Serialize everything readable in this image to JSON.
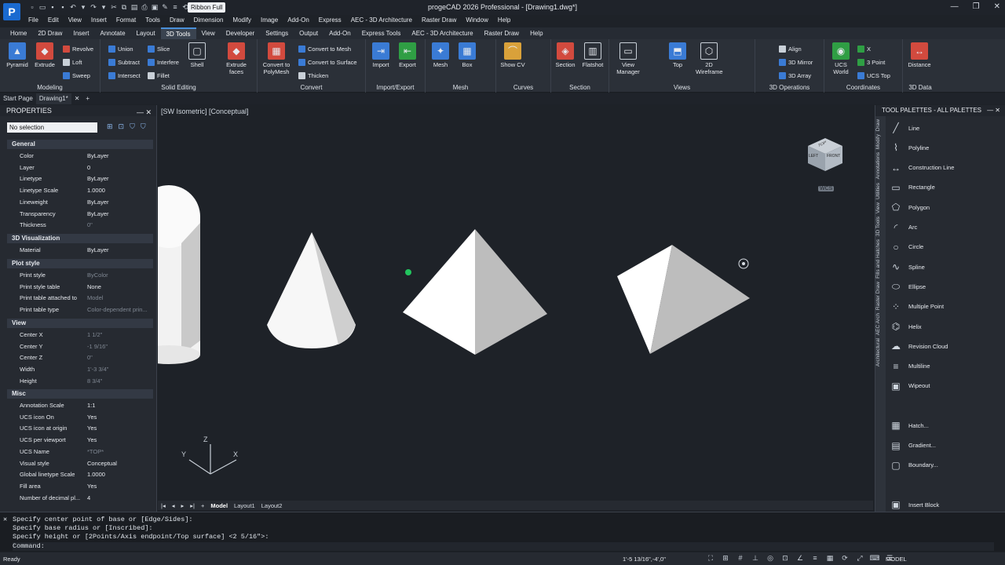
{
  "window": {
    "title": "progeCAD 2026 Professional - [Drawing1.dwg*]",
    "ribbon_toggle": "Ribbon Full",
    "logo": "P"
  },
  "menu": [
    "File",
    "Edit",
    "View",
    "Insert",
    "Format",
    "Tools",
    "Draw",
    "Dimension",
    "Modify",
    "Image",
    "Add-On",
    "Express",
    "AEC - 3D Architecture",
    "Raster Draw",
    "Window",
    "Help"
  ],
  "ribbon_tabs": [
    "Home",
    "2D Draw",
    "Insert",
    "Annotate",
    "Layout",
    "3D Tools",
    "View",
    "Developer",
    "Settings",
    "Output",
    "Add-On",
    "Express Tools",
    "AEC - 3D Architecture",
    "Raster Draw",
    "Help"
  ],
  "ribbon": {
    "modeling": {
      "title": "Modeling",
      "pyramid": "Pyramid",
      "extrude": "Extrude",
      "revolve": "Revolve",
      "loft": "Loft",
      "sweep": "Sweep"
    },
    "solid_editing": {
      "title": "Solid Editing",
      "union": "Union",
      "subtract": "Subtract",
      "intersect": "Intersect",
      "slice": "Slice",
      "interfere": "Interfere",
      "fillet": "Fillet",
      "shell": "Shell",
      "extrude_faces": "Extrude faces"
    },
    "convert": {
      "title": "Convert",
      "to_polymesh": "Convert to PolyMesh",
      "to_mesh": "Convert to Mesh",
      "to_surface": "Convert to Surface",
      "thicken": "Thicken"
    },
    "import_export": {
      "title": "Import/Export",
      "import": "Import",
      "export": "Export"
    },
    "mesh": {
      "title": "Mesh",
      "mesh": "Mesh",
      "box": "Box"
    },
    "curves": {
      "title": "Curves",
      "show_cv": "Show CV"
    },
    "section": {
      "title": "Section",
      "section": "Section",
      "flatshot": "Flatshot"
    },
    "views": {
      "title": "Views",
      "view_manager": "View Manager",
      "top": "Top",
      "wireframe": "2D Wireframe"
    },
    "ops3d": {
      "title": "3D Operations",
      "align": "Align",
      "mirror": "3D Mirror",
      "array": "3D Array"
    },
    "coords": {
      "title": "Coordinates",
      "ucs_world": "UCS World",
      "x": "X",
      "point3": "3 Point",
      "ucs_top": "UCS Top"
    },
    "data3d": {
      "title": "3D Data",
      "distance": "Distance"
    }
  },
  "file_tabs": {
    "start": "Start Page",
    "drawing": "Drawing1*"
  },
  "properties": {
    "header": "PROPERTIES",
    "selection": "No selection",
    "sections": {
      "general": {
        "title": "General",
        "rows": [
          [
            "Color",
            "ByLayer"
          ],
          [
            "Layer",
            "0"
          ],
          [
            "Linetype",
            "ByLayer"
          ],
          [
            "Linetype Scale",
            "1.0000"
          ],
          [
            "Lineweight",
            "ByLayer"
          ],
          [
            "Transparency",
            "ByLayer"
          ],
          [
            "Thickness",
            "0\""
          ]
        ]
      },
      "vis3d": {
        "title": "3D Visualization",
        "rows": [
          [
            "Material",
            "ByLayer"
          ]
        ]
      },
      "plot": {
        "title": "Plot style",
        "rows": [
          [
            "Print style",
            "ByColor"
          ],
          [
            "Print style table",
            "None"
          ],
          [
            "Print table attached to",
            "Model"
          ],
          [
            "Print table type",
            "Color-dependent prin..."
          ]
        ]
      },
      "view": {
        "title": "View",
        "rows": [
          [
            "Center X",
            "1 1/2\""
          ],
          [
            "Center Y",
            "-1 9/16\""
          ],
          [
            "Center Z",
            "0\""
          ],
          [
            "Width",
            "1'-3 3/4\""
          ],
          [
            "Height",
            "8 3/4\""
          ]
        ]
      },
      "misc": {
        "title": "Misc",
        "rows": [
          [
            "Annotation Scale",
            "1:1"
          ],
          [
            "UCS icon On",
            "Yes"
          ],
          [
            "UCS icon at origin",
            "Yes"
          ],
          [
            "UCS per viewport",
            "Yes"
          ],
          [
            "UCS Name",
            "*TOP*"
          ],
          [
            "Visual style",
            "Conceptual"
          ],
          [
            "Global linetype Scale",
            "1.0000"
          ],
          [
            "Fill area",
            "Yes"
          ],
          [
            "Number of decimal pl...",
            "4"
          ]
        ]
      }
    }
  },
  "viewport": {
    "label": "[SW Isometric] [Conceptual]",
    "wcs": "WCS",
    "ucs_z": "Z",
    "ucs_x": "X",
    "ucs_y": "Y",
    "cube": {
      "left": "LEFT",
      "front": "FRONT",
      "top": "TOP"
    }
  },
  "layout_tabs": [
    "Model",
    "Layout1",
    "Layout2"
  ],
  "tool_palettes": {
    "header": "TOOL PALETTES - ALL PALETTES",
    "side_tabs": [
      "Draw",
      "Modify",
      "Annotations",
      "Utilities",
      "View",
      "3D Tools",
      "Fills and Hatches",
      "Raster Draw",
      "AEC Arch",
      "Architectural"
    ],
    "items": [
      "Line",
      "Polyline",
      "Construction Line",
      "Rectangle",
      "Polygon",
      "Arc",
      "Circle",
      "Spline",
      "Ellipse",
      "Multiple Point",
      "Helix",
      "Revision Cloud",
      "Multiline",
      "Wipeout",
      "Hatch...",
      "Gradient...",
      "Boundary...",
      "Insert Block"
    ]
  },
  "command": {
    "lines": [
      "Specify center point of base or [Edge/Sides]:",
      "Specify base radius or [Inscribed]:",
      "Specify height or [2Points/Axis endpoint/Top surface] <2 5/16\">:"
    ],
    "prompt": "Command:"
  },
  "status": {
    "ready": "Ready",
    "coords": "1'-5 13/16\",-4',0\"",
    "model": "MODEL"
  },
  "colors": {
    "accent": "#4a90d9",
    "background": "#1e2228",
    "panel": "#262a31"
  }
}
